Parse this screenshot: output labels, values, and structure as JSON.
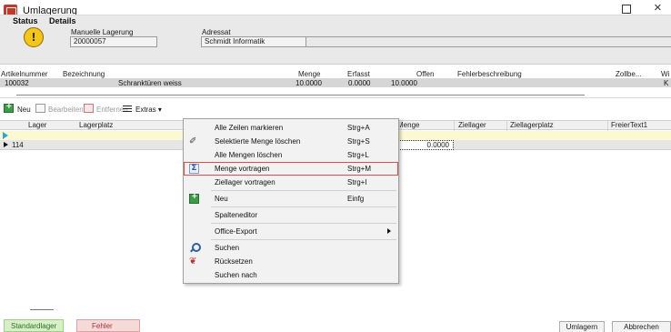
{
  "window": {
    "title": "Umlagerung"
  },
  "header": {
    "status_label": "Status",
    "details_label": "Details",
    "lager_type": "Manuelle Lagerung",
    "order_number": "20000057",
    "adressat_label": "Adressat",
    "adressat_value": "Schmidt Informatik"
  },
  "article_grid": {
    "columns": [
      "Artikelnummer",
      "Bezeichnung",
      "Menge",
      "Erfasst",
      "Offen",
      "Fehlerbeschreibung",
      "Zollbe...",
      "Wi"
    ],
    "row": {
      "artikelnummer": "100032",
      "bezeichnung": "Schranktüren weiss",
      "menge": "10.0000",
      "erfasst": "0.0000",
      "offen": "10.0000",
      "last": "K"
    }
  },
  "toolbar": {
    "neu": "Neu",
    "bearbeiten": "Bearbeiten",
    "entfernen": "Entfernen",
    "extras": "Extras ▾"
  },
  "lower_grid": {
    "columns": [
      "Lager",
      "Lagerplatz",
      "Menge",
      "Ziellager",
      "Ziellagerplatz",
      "FreierText1"
    ],
    "row": {
      "lager": "114",
      "menge": "0.0000"
    }
  },
  "context_menu": {
    "items": [
      {
        "label": "Alle Zeilen markieren",
        "shortcut": "Strg+A"
      },
      {
        "label": "Selektierte Menge löschen",
        "shortcut": "Strg+S"
      },
      {
        "label": "Alle Mengen löschen",
        "shortcut": "Strg+L"
      },
      {
        "label": "Menge vortragen",
        "shortcut": "Strg+M"
      },
      {
        "label": "Ziellager vortragen",
        "shortcut": "Strg+I"
      },
      {
        "label": "Neu",
        "shortcut": "Einfg"
      },
      {
        "label": "Spalteneditor",
        "shortcut": ""
      },
      {
        "label": "Office-Export",
        "shortcut": ""
      },
      {
        "label": "Suchen",
        "shortcut": ""
      },
      {
        "label": "Rücksetzen",
        "shortcut": ""
      },
      {
        "label": "Suchen nach",
        "shortcut": ""
      }
    ]
  },
  "tabs": {
    "standard": "Standardlager",
    "fehler": "Fehler"
  },
  "buttons": {
    "umlagern": "Umlagern",
    "abbrechen": "Abbrechen"
  }
}
